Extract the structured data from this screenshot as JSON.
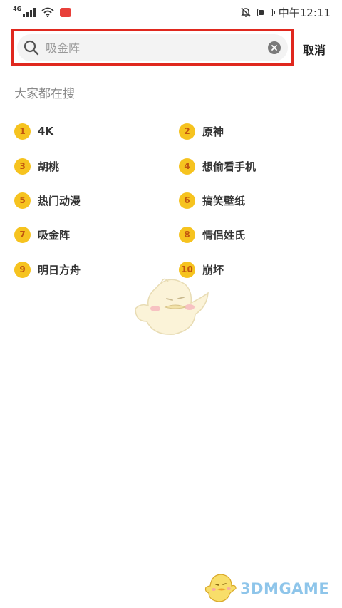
{
  "status_bar": {
    "network": "4G",
    "time": "中午12:11",
    "battery_level": 0.35
  },
  "search": {
    "placeholder": "吸金阵",
    "cancel_label": "取消"
  },
  "section_title": "大家都在搜",
  "hot_searches": [
    {
      "rank": "1",
      "label": "4K"
    },
    {
      "rank": "2",
      "label": "原神"
    },
    {
      "rank": "3",
      "label": "胡桃"
    },
    {
      "rank": "4",
      "label": "想偷看手机"
    },
    {
      "rank": "5",
      "label": "热门动漫"
    },
    {
      "rank": "6",
      "label": "搞笑壁纸"
    },
    {
      "rank": "7",
      "label": "吸金阵"
    },
    {
      "rank": "8",
      "label": "情侣姓氏"
    },
    {
      "rank": "9",
      "label": "明日方舟"
    },
    {
      "rank": "10",
      "label": "崩坏"
    }
  ],
  "watermark": "3DMGAME",
  "colors": {
    "highlight_border": "#e0281e",
    "rank_badge": "#f6c31f",
    "rank_number": "#c2560f",
    "watermark_text": "#8ec5ea"
  },
  "icons": [
    "signal-icon",
    "wifi-icon",
    "app-notification-icon",
    "mute-bell-icon",
    "battery-icon",
    "search-icon",
    "clear-icon"
  ]
}
